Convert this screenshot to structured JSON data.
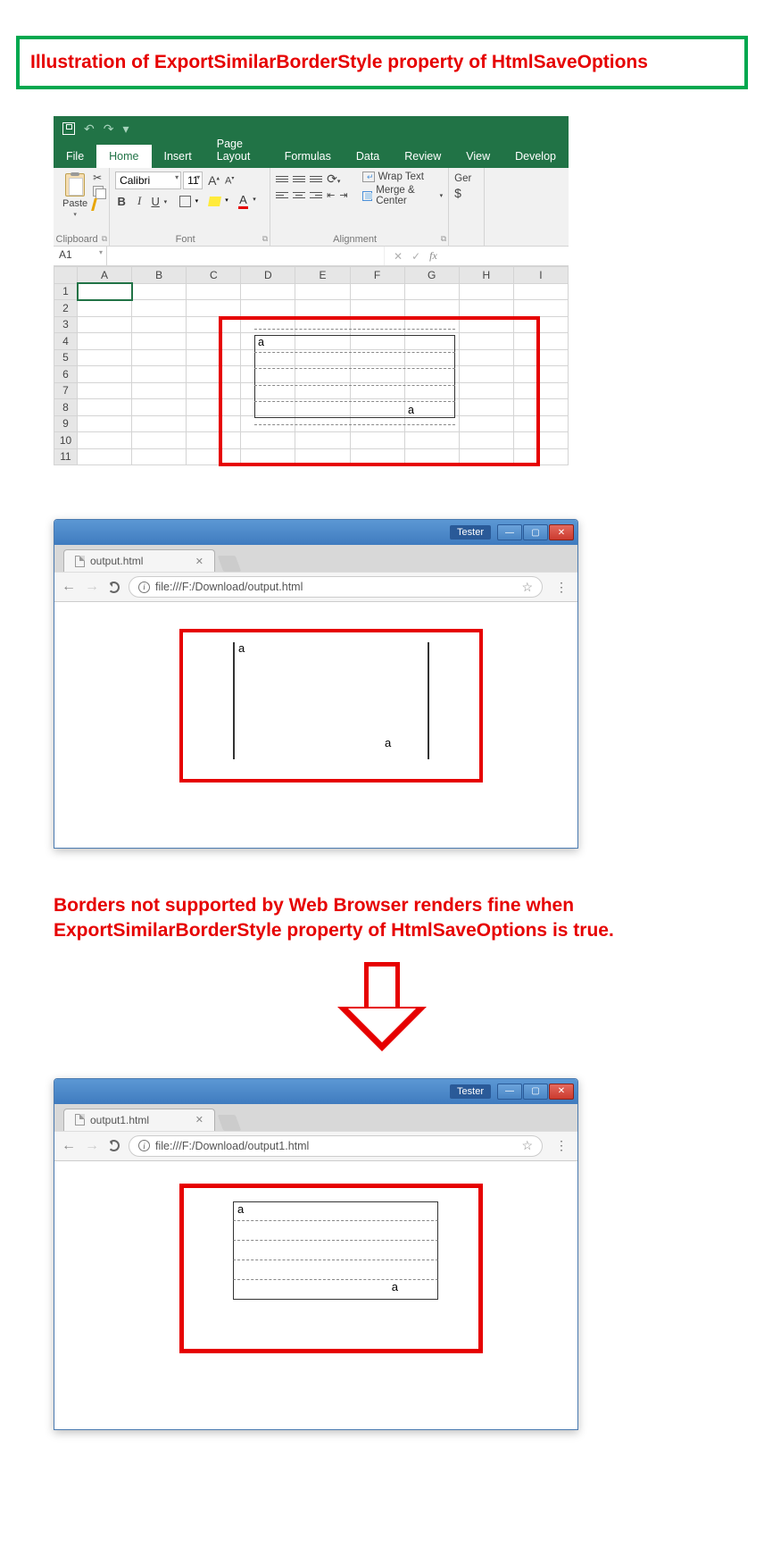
{
  "title": "Illustration of ExportSimilarBorderStyle property of HtmlSaveOptions",
  "excel": {
    "tabs": [
      "File",
      "Home",
      "Insert",
      "Page Layout",
      "Formulas",
      "Data",
      "Review",
      "View",
      "Develop"
    ],
    "activeTab": "Home",
    "clipboard": {
      "paste": "Paste",
      "group": "Clipboard"
    },
    "font": {
      "name": "Calibri",
      "size": "11",
      "group": "Font",
      "bold": "B",
      "italic": "I",
      "underline": "U",
      "colorLetter": "A"
    },
    "alignment": {
      "group": "Alignment",
      "wrap": "Wrap Text",
      "merge": "Merge & Center"
    },
    "number": {
      "format": "Ger",
      "dollar": "$"
    },
    "nameBox": "A1",
    "fx": {
      "cancel": "✕",
      "enter": "✓",
      "label": "fx"
    },
    "cols": [
      "A",
      "B",
      "C",
      "D",
      "E",
      "F",
      "G",
      "H",
      "I"
    ],
    "rows": [
      "1",
      "2",
      "3",
      "4",
      "5",
      "6",
      "7",
      "8",
      "9",
      "10",
      "11"
    ],
    "cellA": "a",
    "cellB": "a"
  },
  "browser1": {
    "user": "Tester",
    "tab": "output.html",
    "url": "file:///F:/Download/output.html",
    "cellA": "a",
    "cellB": "a"
  },
  "caption": "Borders not supported by Web Browser renders fine when ExportSimilarBorderStyle property of HtmlSaveOptions is true.",
  "browser2": {
    "user": "Tester",
    "tab": "output1.html",
    "url": "file:///F:/Download/output1.html",
    "cellA": "a",
    "cellB": "a"
  }
}
